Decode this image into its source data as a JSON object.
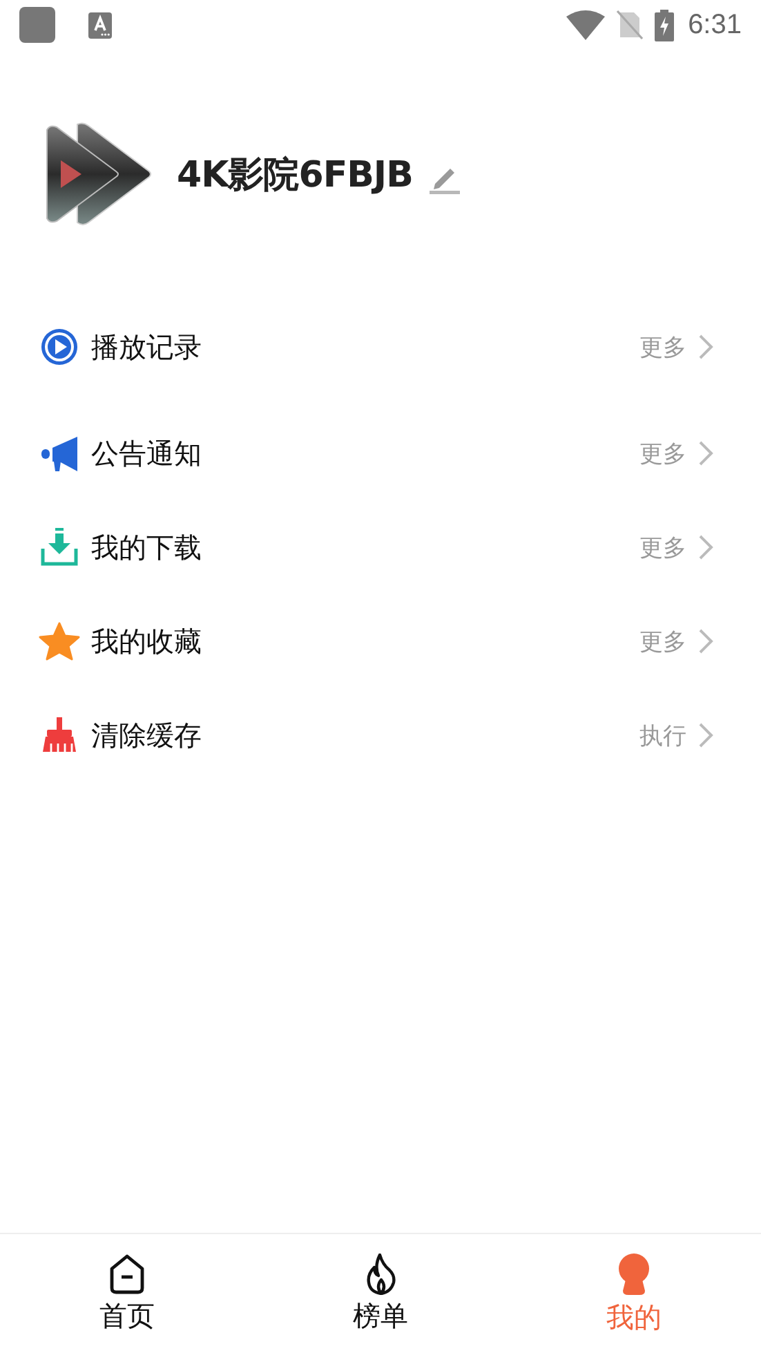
{
  "status_bar": {
    "time": "6:31"
  },
  "profile": {
    "name": "4K影院6FBJB"
  },
  "menu": [
    {
      "label": "播放记录",
      "action": "更多"
    },
    {
      "label": "公告通知",
      "action": "更多"
    },
    {
      "label": "我的下载",
      "action": "更多"
    },
    {
      "label": "我的收藏",
      "action": "更多"
    },
    {
      "label": "清除缓存",
      "action": "执行"
    }
  ],
  "tabs": [
    {
      "label": "首页",
      "selected": false
    },
    {
      "label": "榜单",
      "selected": false
    },
    {
      "label": "我的",
      "selected": true
    }
  ]
}
